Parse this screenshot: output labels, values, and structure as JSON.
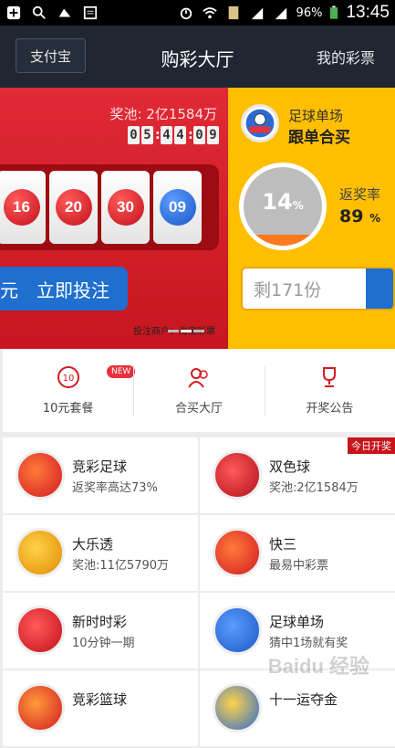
{
  "status_bar": {
    "battery": "96%",
    "time": "13:45"
  },
  "header": {
    "alipay_label": "支付宝",
    "title": "购彩大厅",
    "my_lottery_label": "我的彩票"
  },
  "banner_red": {
    "jackpot": "奖池: 2亿1584万",
    "countdown": [
      "0",
      "5",
      "4",
      "4",
      "0",
      "9"
    ],
    "balls": [
      "16",
      "20",
      "30",
      "09"
    ],
    "bet_button": "立即投注",
    "bet_prefix": "元"
  },
  "banner_yellow": {
    "title": "足球单场",
    "subtitle": "跟单合买",
    "progress_value": "14",
    "progress_unit": "%",
    "progress_fraction": 0.14,
    "rebate_label": "返奖率",
    "rebate_value": "89",
    "rebate_unit": "%",
    "shares_text": "剩171份"
  },
  "banner_note": "投注商户：淘宝彩票",
  "shortcuts": [
    {
      "label": "10元套餐",
      "badge": "NEW",
      "icon": "ten-yuan-icon"
    },
    {
      "label": "合买大厅",
      "icon": "group-buy-icon"
    },
    {
      "label": "开奖公告",
      "icon": "trophy-icon"
    }
  ],
  "lotteries": [
    {
      "name": "竞彩足球",
      "desc": "返奖率高达73%",
      "icon": "football-lottery-icon",
      "color": "#e8323c"
    },
    {
      "name": "双色球",
      "desc": "奖池:2亿1584万",
      "icon": "double-color-ball-icon",
      "color": "#d31a22",
      "tag": "今日开奖"
    },
    {
      "name": "大乐透",
      "desc": "奖池:11亿5790万",
      "icon": "super-lotto-icon",
      "color": "#f2a300"
    },
    {
      "name": "快三",
      "desc": "最易中彩票",
      "icon": "fast-three-icon",
      "color": "#e8323c"
    },
    {
      "name": "新时时彩",
      "desc": "10分钟一期",
      "icon": "time-lottery-icon",
      "color": "#e8323c"
    },
    {
      "name": "足球单场",
      "desc": "猜中1场就有奖",
      "icon": "football-single-icon",
      "color": "#2d6bd0"
    },
    {
      "name": "竞彩篮球",
      "desc": "",
      "icon": "basketball-lottery-icon",
      "color": "#e8323c"
    },
    {
      "name": "十一运夺金",
      "desc": "",
      "icon": "eleven-five-icon",
      "color": "#2d6bd0"
    }
  ],
  "watermark": "Baidu 经验"
}
